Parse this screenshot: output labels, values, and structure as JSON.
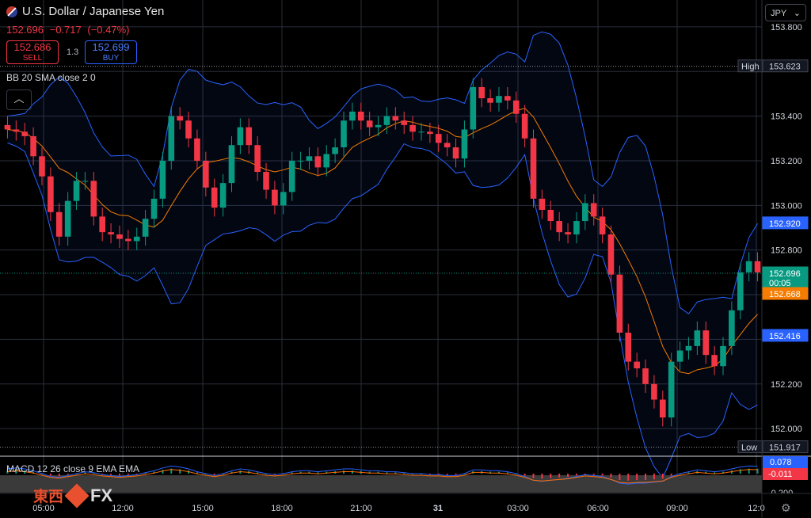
{
  "header": {
    "title": "U.S. Dollar / Japanese Yen",
    "price": "152.696",
    "change": "−0.717",
    "change_pct": "(−0.47%)",
    "sell_price": "152.686",
    "sell_label": "SELL",
    "buy_price": "152.699",
    "buy_label": "BUY",
    "spread": "1.3",
    "bb_label": "BB 20 SMA close 2 0",
    "currency": "JPY",
    "macd_label": "MACD 12 26 close 9 EMA EMA"
  },
  "brand": {
    "cn": "東西",
    "fx": "FX"
  },
  "colors": {
    "up": "#089981",
    "down": "#f23645",
    "bb_band": "#2962ff",
    "sma": "#f57c00",
    "macd": "#2962ff",
    "signal": "#ff6d00"
  },
  "chart_data": {
    "type": "candlestick",
    "y_ticks": [
      152.0,
      152.2,
      152.4,
      152.6,
      152.8,
      153.0,
      153.2,
      153.4,
      153.6,
      153.8
    ],
    "y_tick_labels": [
      "152.000",
      "152.200",
      "",
      "",
      "152.800",
      "153.000",
      "153.200",
      "153.400",
      "",
      "153.800"
    ],
    "x_ticks": [
      "05:00",
      "12:00",
      "15:00",
      "18:00",
      "21:00",
      "31",
      "03:00",
      "06:00",
      "09:00",
      "12:0"
    ],
    "closes": [
      153.34,
      153.33,
      153.31,
      153.22,
      153.13,
      152.97,
      152.86,
      153.02,
      153.11,
      153.11,
      152.95,
      152.88,
      152.87,
      152.85,
      152.84,
      152.86,
      152.94,
      153.03,
      153.2,
      153.4,
      153.38,
      153.3,
      153.2,
      153.08,
      152.99,
      153.1,
      153.27,
      153.35,
      153.27,
      153.15,
      153.07,
      153.0,
      153.06,
      153.2,
      153.2,
      153.22,
      153.17,
      153.23,
      153.26,
      153.38,
      153.42,
      153.38,
      153.35,
      153.36,
      153.4,
      153.38,
      153.36,
      153.33,
      153.33,
      153.32,
      153.28,
      153.26,
      153.21,
      153.34,
      153.53,
      153.48,
      153.46,
      153.49,
      153.47,
      153.41,
      153.3,
      153.03,
      152.98,
      152.93,
      152.88,
      152.87,
      152.93,
      153.01,
      152.95,
      152.87,
      152.69,
      152.43,
      152.3,
      152.27,
      152.2,
      152.13,
      152.05,
      152.3,
      152.35,
      152.37,
      152.44,
      152.33,
      152.28,
      152.37,
      152.53,
      152.7,
      152.75,
      152.7
    ],
    "high": "153.623",
    "low": "151.917",
    "price_tags": [
      {
        "label": "High",
        "value": "153.623"
      },
      {
        "label": "",
        "value": "152.920"
      },
      {
        "label": "",
        "value": "152.696",
        "timer": "00:05"
      },
      {
        "label": "",
        "value": "152.668"
      },
      {
        "label": "",
        "value": "152.416"
      },
      {
        "label": "Low",
        "value": "151.917"
      }
    ],
    "macd": {
      "y_tick": "-0.200",
      "tags": [
        {
          "value": "0.078"
        },
        {
          "value": "-0.011"
        }
      ],
      "hist": [
        0.05,
        0.06,
        0.05,
        0.03,
        0.0,
        -0.03,
        -0.04,
        -0.02,
        0.0,
        0.02,
        0.01,
        -0.01,
        -0.02,
        -0.03,
        -0.02,
        -0.01,
        0.01,
        0.03,
        0.06,
        0.08,
        0.07,
        0.05,
        0.02,
        0.0,
        -0.02,
        0.0,
        0.03,
        0.05,
        0.04,
        0.02,
        0.0,
        -0.01,
        0.0,
        0.02,
        0.03,
        0.03,
        0.02,
        0.03,
        0.04,
        0.05,
        0.05,
        0.04,
        0.03,
        0.03,
        0.02,
        0.02,
        0.01,
        0.0,
        0.0,
        -0.01,
        -0.01,
        -0.02,
        -0.02,
        0.0,
        0.04,
        0.04,
        0.03,
        0.03,
        0.02,
        0.0,
        -0.03,
        -0.07,
        -0.08,
        -0.07,
        -0.06,
        -0.05,
        -0.03,
        -0.01,
        -0.02,
        -0.03,
        -0.06,
        -0.1,
        -0.11,
        -0.1,
        -0.1,
        -0.09,
        -0.08,
        -0.03,
        0.0,
        0.02,
        0.04,
        0.03,
        0.02,
        0.03,
        0.05,
        0.07,
        0.08,
        0.078
      ]
    }
  }
}
